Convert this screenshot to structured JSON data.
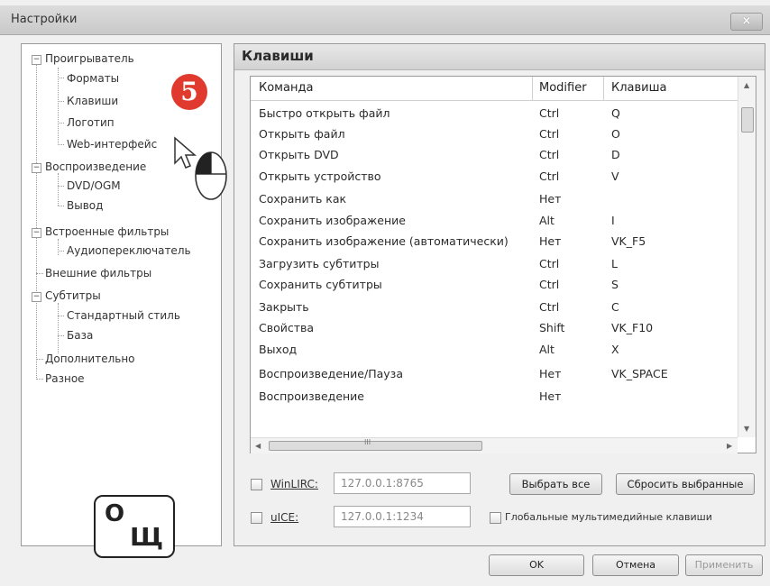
{
  "window": {
    "title": "Настройки",
    "close_label": "×"
  },
  "tree": {
    "items": [
      {
        "label": "Проигрыватель"
      },
      {
        "label": "Форматы"
      },
      {
        "label": "Клавиши"
      },
      {
        "label": "Логотип"
      },
      {
        "label": "Web-интерфейс"
      },
      {
        "label": "Воспроизведение"
      },
      {
        "label": "DVD/OGM"
      },
      {
        "label": "Вывод"
      },
      {
        "label": "Встроенные фильтры"
      },
      {
        "label": "Аудиопереключатель"
      },
      {
        "label": "Внешние фильтры"
      },
      {
        "label": "Субтитры"
      },
      {
        "label": "Стандартный стиль"
      },
      {
        "label": "База"
      },
      {
        "label": "Дополнительно"
      },
      {
        "label": "Разное"
      }
    ]
  },
  "step_badge": "5",
  "shortcut_key": {
    "top": "О",
    "bottom": "Щ"
  },
  "section": {
    "title": "Клавиши"
  },
  "table": {
    "headers": {
      "command": "Команда",
      "modifier": "Modifier",
      "key": "Клавиша"
    },
    "rows": [
      {
        "command": "Быстро открыть файл",
        "modifier": "Ctrl",
        "key": "Q"
      },
      {
        "command": "Открыть файл",
        "modifier": "Ctrl",
        "key": "O"
      },
      {
        "command": "Открыть DVD",
        "modifier": "Ctrl",
        "key": "D"
      },
      {
        "command": "Открыть устройство",
        "modifier": "Ctrl",
        "key": "V"
      },
      {
        "command": "Сохранить как",
        "modifier": "Нет",
        "key": ""
      },
      {
        "command": "Сохранить изображение",
        "modifier": "Alt",
        "key": "I"
      },
      {
        "command": "Сохранить изображение (автоматически)",
        "modifier": "Нет",
        "key": "VK_F5"
      },
      {
        "command": "Загрузить субтитры",
        "modifier": "Ctrl",
        "key": "L"
      },
      {
        "command": "Сохранить субтитры",
        "modifier": "Ctrl",
        "key": "S"
      },
      {
        "command": "Закрыть",
        "modifier": "Ctrl",
        "key": "C"
      },
      {
        "command": "Свойства",
        "modifier": "Shift",
        "key": "VK_F10"
      },
      {
        "command": "Выход",
        "modifier": "Alt",
        "key": "X"
      },
      {
        "command": "Воспроизведение/Пауза",
        "modifier": "Нет",
        "key": "VK_SPACE"
      },
      {
        "command": "Воспроизведение",
        "modifier": "Нет",
        "key": ""
      }
    ],
    "hscroll_grip": "III"
  },
  "winlirc": {
    "label": "WinLIRC:",
    "value": "127.0.0.1:8765"
  },
  "uice": {
    "label": "uICE:",
    "value": "127.0.0.1:1234"
  },
  "buttons": {
    "select_all": "Выбрать все",
    "reset_selected": "Сбросить выбранные",
    "global_keys": "Глобальные мультимедийные клавиши",
    "ok": "OK",
    "cancel": "Отмена",
    "apply": "Применить"
  }
}
